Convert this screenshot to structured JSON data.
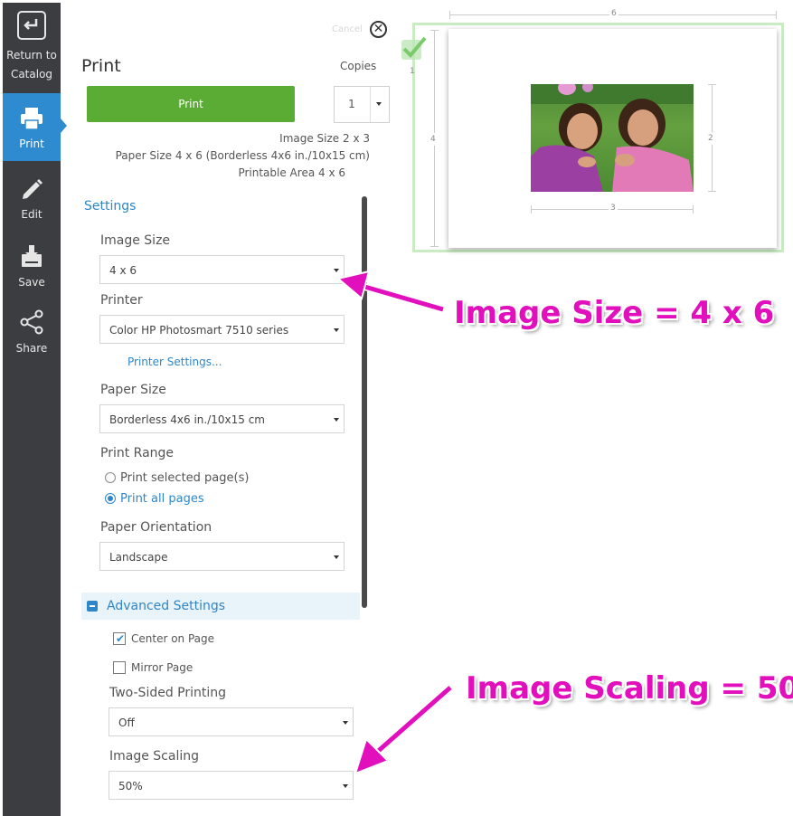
{
  "nav": {
    "items": [
      {
        "label": "Return to Catalog",
        "icon": "return-icon"
      },
      {
        "label": "Print",
        "icon": "printer-icon",
        "active": true
      },
      {
        "label": "Edit",
        "icon": "pencil-icon"
      },
      {
        "label": "Save",
        "icon": "save-icon"
      },
      {
        "label": "Share",
        "icon": "share-icon"
      }
    ]
  },
  "panel": {
    "title": "Print",
    "copies_label": "Copies",
    "copies_value": "1",
    "print_button": "Print",
    "cancel_label": "Cancel",
    "info": {
      "image_size": "Image Size 2 x 3",
      "paper_size": "Paper Size 4 x 6 (Borderless 4x6 in./10x15 cm)",
      "printable_area": "Printable Area 4 x 6"
    },
    "settings": {
      "heading": "Settings",
      "image_size_label": "Image Size",
      "image_size_value": "4 x 6",
      "printer_label": "Printer",
      "printer_value": "Color HP Photosmart 7510 series",
      "printer_settings_link": "Printer Settings...",
      "paper_size_label": "Paper Size",
      "paper_size_value": "Borderless 4x6 in./10x15 cm",
      "print_range_label": "Print Range",
      "range_selected": "Print selected page(s)",
      "range_all": "Print all pages",
      "range_choice": "all",
      "orientation_label": "Paper Orientation",
      "orientation_value": "Landscape"
    },
    "advanced": {
      "heading": "Advanced Settings",
      "center_on_page": "Center on Page",
      "center_checked": true,
      "mirror_page": "Mirror Page",
      "mirror_checked": false,
      "two_sided_label": "Two-Sided Printing",
      "two_sided_value": "Off",
      "scaling_label": "Image Scaling",
      "scaling_value": "50%"
    }
  },
  "preview": {
    "page_number": "1",
    "paper_width_label": "6",
    "paper_height_label": "4",
    "image_width_label": "3",
    "image_height_label": "2"
  },
  "annotations": {
    "image_size": "Image Size = 4 x 6",
    "image_scaling": "Image Scaling = 50%"
  },
  "colors": {
    "accent_blue": "#2f86c6",
    "print_green": "#5aac34",
    "annotation_magenta": "#e20fbd",
    "nav_bg": "#3b3d40"
  }
}
